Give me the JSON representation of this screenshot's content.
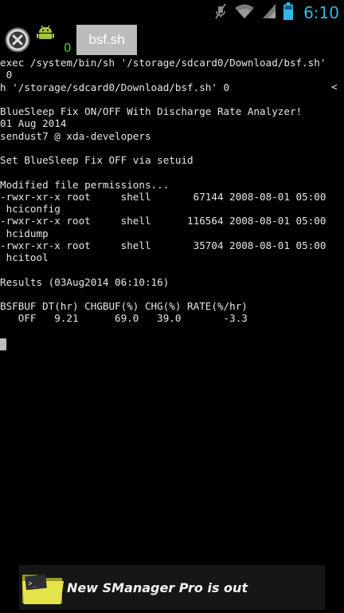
{
  "status_bar": {
    "time": "6:10",
    "icons": [
      "mute-icon",
      "wifi-icon",
      "signal-icon",
      "battery-icon"
    ]
  },
  "toolbar": {
    "window_count": "0",
    "tab_label": "bsf.sh"
  },
  "terminal": {
    "lines": [
      "exec /system/bin/sh '/storage/sdcard0/Download/bsf.sh'",
      " 0",
      "h '/storage/sdcard0/Download/bsf.sh' 0",
      "",
      "BlueSleep Fix ON/OFF With Discharge Rate Analyzer!",
      "01 Aug 2014",
      "sendust7 @ xda-developers",
      "",
      "Set BlueSleep Fix OFF via setuid",
      "",
      "Modified file permissions...",
      "-rwxr-xr-x root     shell       67144 2008-08-01 05:00",
      " hciconfig",
      "-rwxr-xr-x root     shell      116564 2008-08-01 05:00",
      " hcidump",
      "-rwxr-xr-x root     shell       35704 2008-08-01 05:00",
      " hcitool",
      "",
      "Results (03Aug2014 06:10:16)",
      "",
      "BSFBUF DT(hr) CHGBUF(%) CHG(%) RATE(%/hr)",
      "   OFF   9.21      69.0   39.0       -3.3"
    ],
    "overflow_marker": "<"
  },
  "ad": {
    "text": "New SManager Pro is out"
  },
  "colors": {
    "clock": "#33b5e5",
    "window_count": "#35d535",
    "tab_bg": "#bcbcbc"
  }
}
